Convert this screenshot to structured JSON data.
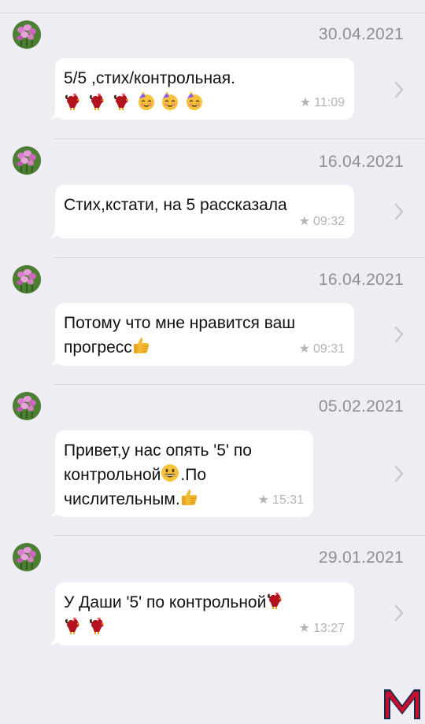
{
  "messages": [
    {
      "date": "30.04.2021",
      "lines": [
        "5/5 ,стих/контрольная."
      ],
      "emojis_after": [
        "rooster",
        "rooster",
        "rooster",
        "partying-face",
        "partying-face",
        "partying-face"
      ],
      "time": "11:09"
    },
    {
      "date": "16.04.2021",
      "lines": [
        "Стих,кстати, на 5 рассказала"
      ],
      "time": "09:32"
    },
    {
      "date": "16.04.2021",
      "lines": [
        "Потому что мне нравится ваш",
        "прогресс"
      ],
      "trailing_emoji": "thumbs-up",
      "time": "09:31"
    },
    {
      "date": "05.02.2021",
      "lines": [
        "Привет,у нас опять '5' по",
        "контрольной",
        ".По",
        "числительным."
      ],
      "time": "15:31"
    },
    {
      "date": "29.01.2021",
      "lines": [
        "У Даши '5' по контрольной"
      ],
      "time": "13:27"
    }
  ],
  "logo": {
    "letter": "M",
    "color": "#c8102e",
    "dark": "#1b2a4a"
  },
  "colors": {
    "background": "#eeedf3",
    "bubble": "#ffffff",
    "meta": "#b4b4b8",
    "date": "#8e8e93"
  }
}
